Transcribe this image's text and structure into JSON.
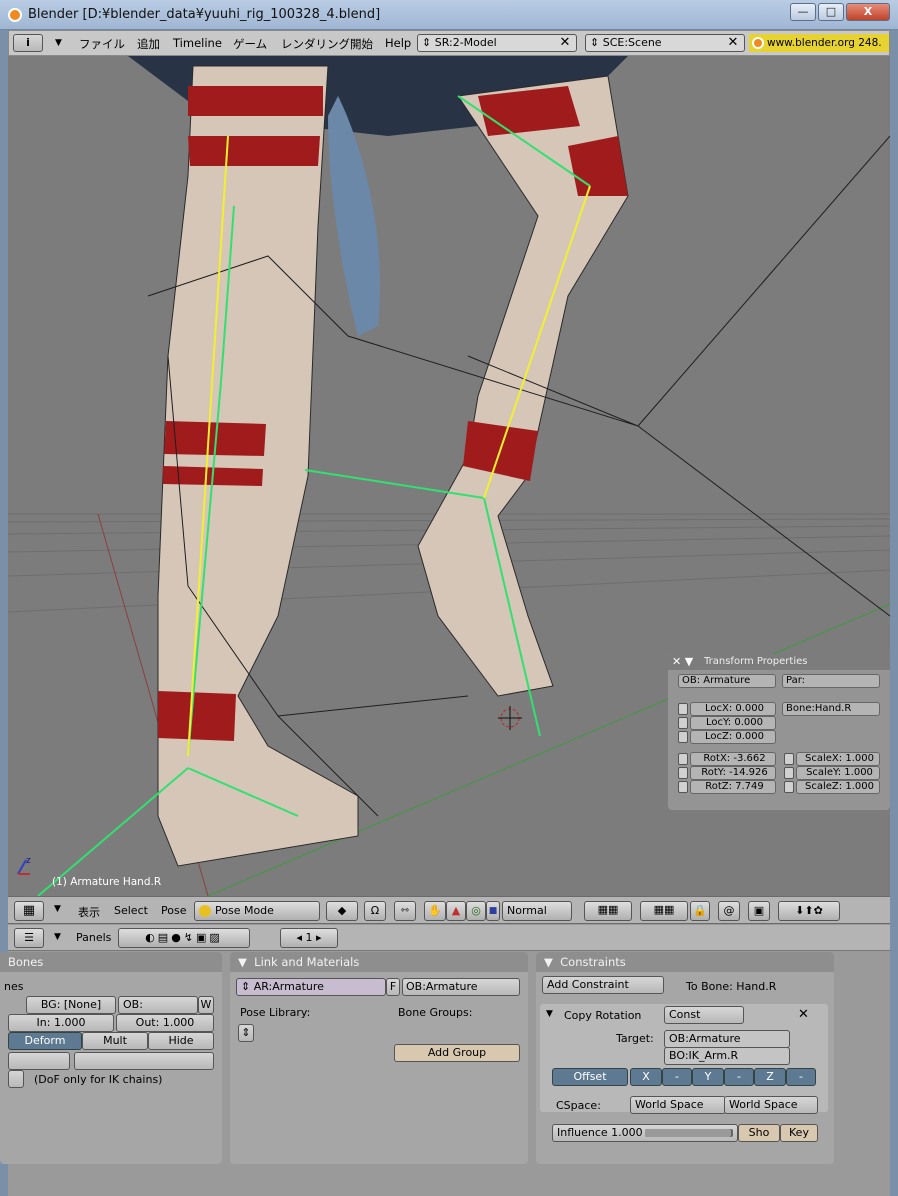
{
  "window": {
    "title": "Blender [D:¥blender_data¥yuuhi_rig_100328_4.blend]",
    "min": "—",
    "max": "□",
    "close": "X"
  },
  "menubar": {
    "info_btn": "i",
    "items": [
      "ファイル",
      "追加",
      "Timeline",
      "ゲーム",
      "レンダリング開始",
      "Help"
    ],
    "screen": "SR:2-Model",
    "scene": "SCE:Scene",
    "url": "www.blender.org 248."
  },
  "viewport": {
    "status": "(1) Armature Hand.R",
    "axis_z": "z"
  },
  "transform": {
    "title": "Transform Properties",
    "ob": "OB: Armature",
    "par": "Par:",
    "bone": "Bone:Hand.R",
    "loc": [
      "LocX: 0.000",
      "LocY: 0.000",
      "LocZ: 0.000"
    ],
    "rot": [
      "RotX: -3.662",
      "RotY: -14.926",
      "RotZ: 7.749"
    ],
    "scale": [
      "ScaleX: 1.000",
      "ScaleY: 1.000",
      "ScaleZ: 1.000"
    ]
  },
  "header3d": {
    "view": "表示",
    "select": "Select",
    "pose": "Pose",
    "mode": "Pose Mode",
    "pivot": "Normal"
  },
  "buttons": {
    "panels": "Panels",
    "frame": "1"
  },
  "bones": {
    "title": "Bones",
    "label": "nes",
    "bg": "BG: [None]",
    "ob": "OB:",
    "w": "W",
    "in": "In: 1.000",
    "out": "Out: 1.000",
    "deform": "Deform",
    "mult": "Mult",
    "hide": "Hide",
    "dof": "(DoF only for IK chains)"
  },
  "linkmat": {
    "title": "Link and Materials",
    "ar": "AR:Armature",
    "f": "F",
    "ob": "OB:Armature",
    "pose_lib": "Pose Library:",
    "bone_groups": "Bone Groups:",
    "add_group": "Add Group"
  },
  "constraints": {
    "title": "Constraints",
    "add": "Add Constraint",
    "to_bone": "To Bone: Hand.R",
    "name": "Copy Rotation",
    "const": "Const",
    "target_label": "Target:",
    "target_ob": "OB:Armature",
    "target_bo": "BO:IK_Arm.R",
    "offset": "Offset",
    "axes": [
      "X",
      "-",
      "Y",
      "-",
      "Z",
      "-"
    ],
    "cspace_label": "CSpace:",
    "cspace1": "World Space",
    "cspace2": "World Space",
    "influence": "Influence 1.000",
    "influence_value": 0.98,
    "sho": "Sho",
    "key": "Key"
  }
}
